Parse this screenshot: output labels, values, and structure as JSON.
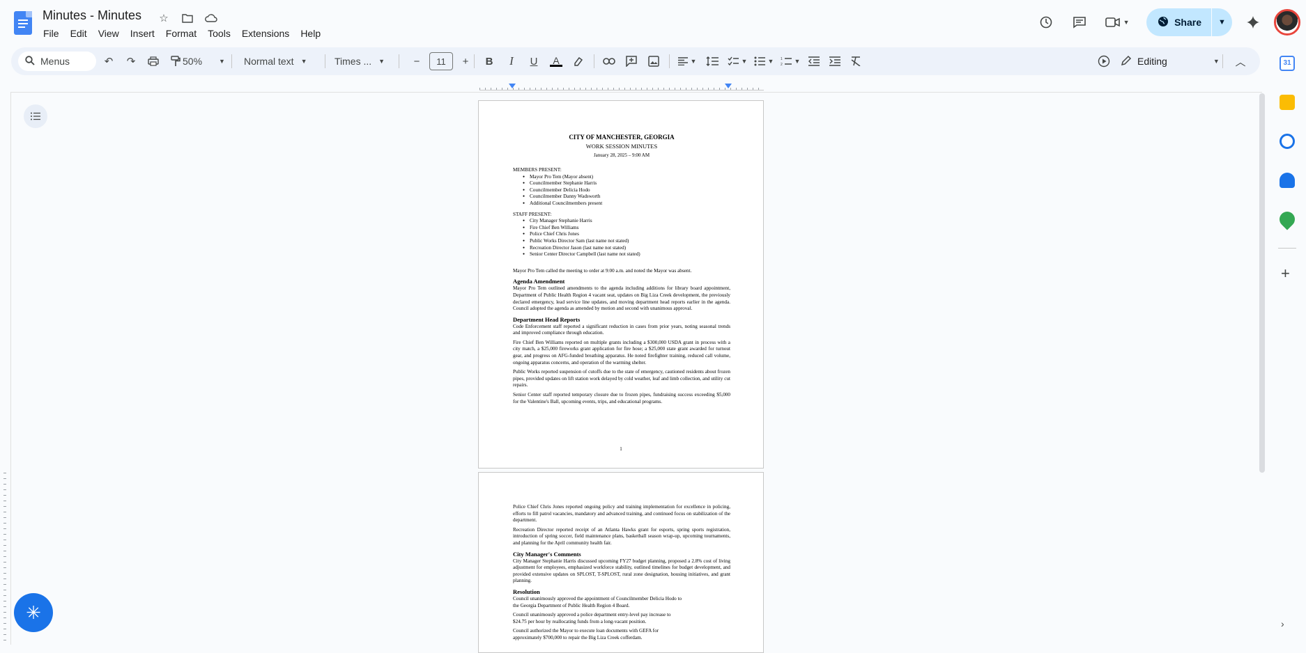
{
  "app": {
    "title": "Minutes - Minutes",
    "menus": [
      "File",
      "Edit",
      "View",
      "Insert",
      "Format",
      "Tools",
      "Extensions",
      "Help"
    ],
    "share_label": "Share"
  },
  "toolbar": {
    "search_placeholder": "Menus",
    "zoom": "50%",
    "style": "Normal text",
    "font": "Times ...",
    "font_size": "11",
    "mode": "Editing"
  },
  "doc": {
    "page1": {
      "title": "CITY OF MANCHESTER, GEORGIA",
      "subtitle": "WORK SESSION MINUTES",
      "date": "January 28, 2025 – 9:00 AM",
      "members_heading": "MEMBERS PRESENT:",
      "members": [
        "Mayor Pro Tem (Mayor absent)",
        "Councilmember Stephanie Harris",
        "Councilmember Delicia Hodo",
        "Councilmember Danny Wadsworth",
        "Additional Councilmembers present"
      ],
      "staff_heading": "STAFF PRESENT:",
      "staff": [
        "City Manager Stephanie Harris",
        "Fire Chief Ben Williams",
        "Police Chief Chris Jones",
        "Public Works Director Sam (last name not stated)",
        "Recreation Director Jason (last name not stated)",
        "Senior Center Director Campbell (last name not stated)"
      ],
      "call_to_order": "Mayor Pro Tem called the meeting to order at 9:00 a.m. and noted the Mayor was absent.",
      "agenda_heading": "Agenda Amendment",
      "agenda_text": "Mayor Pro Tem outlined amendments to the agenda including additions for library board appointment, Department of Public Health Region 4 vacant seat, updates on Big Liza Creek development, the previously declared emergency, lead service line updates, and moving department head reports earlier in the agenda. Council adopted the agenda as amended by motion and second with unanimous approval.",
      "dept_heading": "Department Head Reports",
      "dept_paras": [
        "Code Enforcement staff reported a significant reduction in cases from prior years, noting seasonal trends and improved compliance through education.",
        "Fire Chief Ben Williams reported on multiple grants including a $300,000 USDA grant in process with a city match, a $25,000 fireworks grant application for fire hose; a $25,000 state grant awarded for turnout gear, and progress on AFG-funded breathing apparatus. He noted firefighter training, reduced call volume, ongoing apparatus concerns, and operation of the warming shelter.",
        "Public Works reported suspension of cutoffs due to the state of emergency, cautioned residents about frozen pipes, provided updates on lift station work delayed by cold weather, leaf and limb collection, and utility cut repairs.",
        "Senior Center staff reported temporary closure due to frozen pipes, fundraising success exceeding $5,000 for the Valentine's Ball, upcoming events, trips, and educational programs."
      ],
      "page_number": "1"
    },
    "page2": {
      "paras": [
        "Police Chief Chris Jones reported ongoing policy and training implementation for excellence in policing, efforts to fill patrol vacancies, mandatory and advanced training, and continued focus on stabilization of the department.",
        "Recreation Director reported receipt of an Atlanta Hawks grant for esports, spring sports registration, introduction of spring soccer, field maintenance plans, basketball season wrap-up, upcoming tournaments, and planning for the April community health fair."
      ],
      "cm_heading": "City Manager's Comments",
      "cm_text": "City Manager Stephanie Harris discussed upcoming FY27 budget planning, proposed a 2.8% cost of living adjustment for employees, emphasized workforce stability, outlined timelines for budget development, and provided extensive updates on SPLOST, T-SPLOST, rural zone designation, housing initiatives, and grant planning.",
      "res_heading": "Resolution",
      "res_items": [
        "Council unanimously approved the appointment of Councilmember Delicia Hodo to the Georgia Department of Public Health Region 4 Board.",
        "Council unanimously approved a police department entry-level pay increase to $24.75 per hour by reallocating funds from a long-vacant position.",
        "Council authorized the Mayor to execute loan documents with GEFA for approximately $700,000 to repair the Big Liza Creek cofferdam."
      ]
    }
  },
  "colors": {
    "accent": "#1a73e8",
    "share_bg": "#c2e7ff",
    "toolbar_bg": "#edf2fa"
  }
}
